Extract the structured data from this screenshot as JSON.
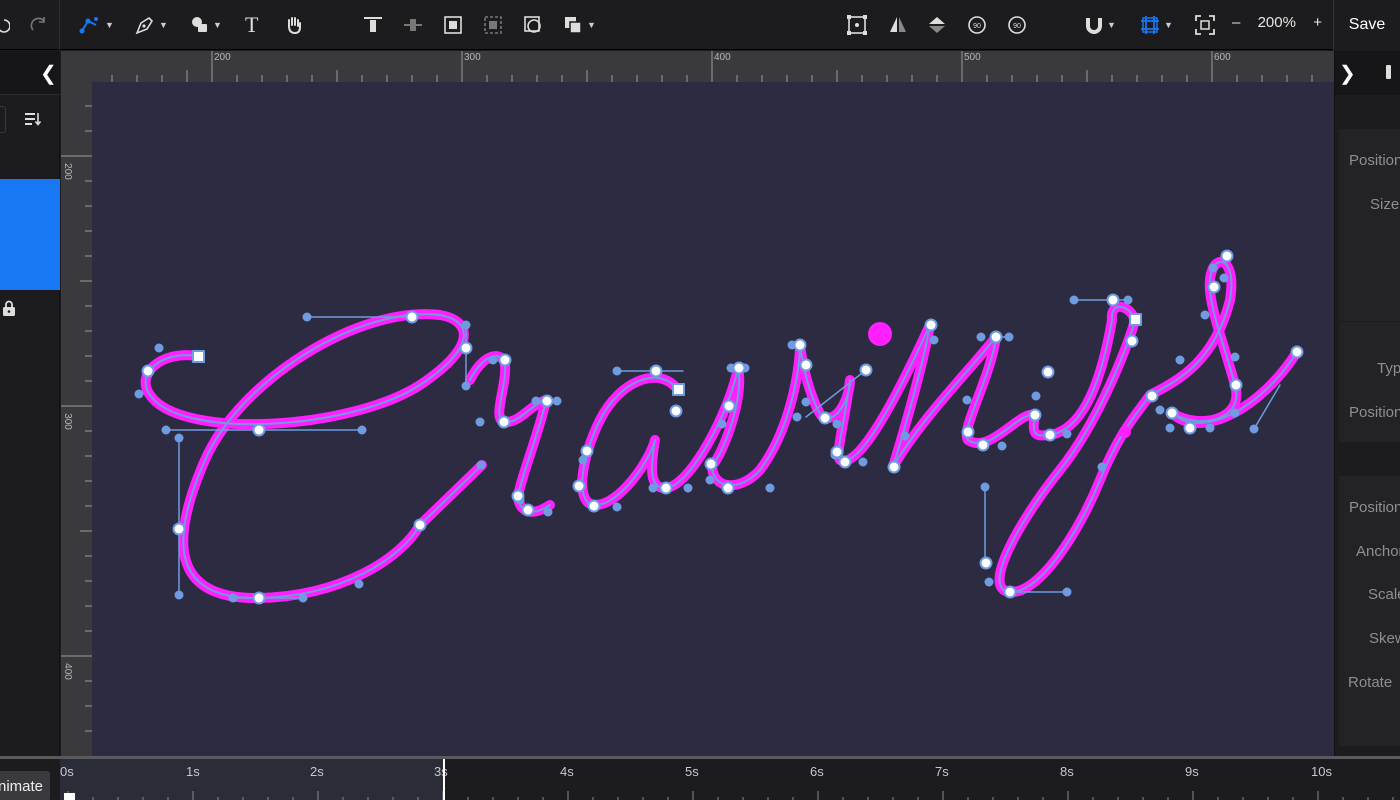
{
  "toolbar": {
    "save_label": "Save",
    "zoom_level": "200%",
    "zoom_minus": "–",
    "zoom_plus": "+",
    "text_tool": "T",
    "accent_color": "#1877f2"
  },
  "ruler": {
    "top_labels": [
      "200",
      "300",
      "400",
      "500",
      "600"
    ],
    "left_labels": [
      "200",
      "300",
      "400"
    ]
  },
  "properties": {
    "labels": [
      "Position",
      "Size",
      "Type",
      "Position",
      "Position",
      "Anchor",
      "Scale",
      "Skew",
      "Rotate"
    ]
  },
  "timeline": {
    "animate_label": "Animate",
    "time_labels": [
      "0s",
      "1s",
      "2s",
      "3s",
      "4s",
      "5s",
      "6s",
      "7s",
      "8s",
      "9s",
      "10s"
    ],
    "playhead": "3s"
  },
  "canvas": {
    "background": "#2d2b42",
    "stroke_color": "#ff1fff",
    "path_color": "#6f9be0"
  }
}
